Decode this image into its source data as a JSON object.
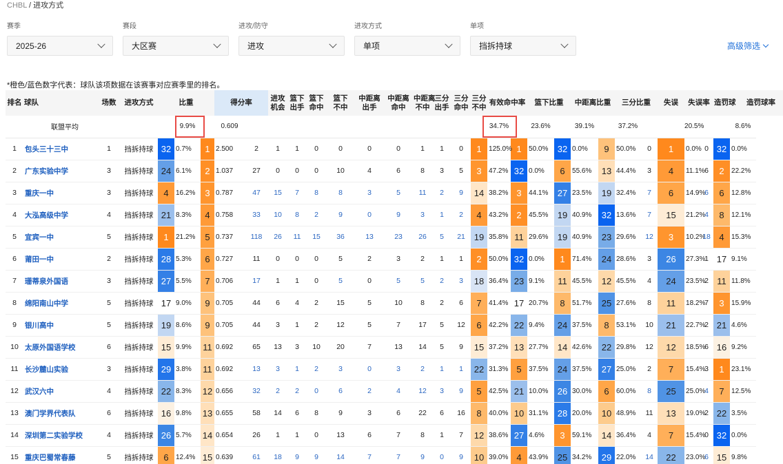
{
  "breadcrumb": {
    "root": "CHBL",
    "sep": " / ",
    "current": "进攻方式"
  },
  "filters": [
    {
      "label": "赛季",
      "value": "2025-26"
    },
    {
      "label": "赛段",
      "value": "大区赛"
    },
    {
      "label": "进攻/防守",
      "value": "进攻"
    },
    {
      "label": "进攻方式",
      "value": "单项"
    },
    {
      "label": "单项",
      "value": "挡拆持球"
    }
  ],
  "advanced_filter": "高级筛选",
  "note": "*橙色/蓝色数字代表：球队该项数据在该赛事对应赛季里的排名。",
  "columns": [
    "排名",
    "球队",
    "场数",
    "进攻方式",
    "比重",
    "得分率",
    "进攻\n机会",
    "篮下\n出手",
    "篮下\n命中",
    "篮下\n不中",
    "中距离\n出手",
    "中距离\n命中",
    "中距离\n不中",
    "三分\n出手",
    "三分\n命中",
    "三分\n不中",
    "有效命中率",
    "篮下比重",
    "中距离比重",
    "三分比重",
    "失误",
    "失误率",
    "造罚球",
    "造罚球率"
  ],
  "average_row": {
    "label": "联盟平均",
    "share": "9.9%",
    "ppp": "0.609",
    "efg": "34.7%",
    "rim_share": "23.6%",
    "mid_share": "39.1%",
    "three_share": "37.2%",
    "tov_rate": "20.5%",
    "ft_rate": "8.6%"
  },
  "rows": [
    {
      "rank": "1",
      "team": "包头三十三中",
      "games": "1",
      "type": "挡拆持球",
      "share_rk": "32",
      "share": "0.7%",
      "ppp_rk": "1",
      "ppp": "2.500",
      "poss": "2",
      "rim_fga": "1",
      "rim_fgm": "1",
      "rim_miss": "0",
      "mid_fga": "0",
      "mid_fgm": "0",
      "mid_miss": "0",
      "three_fga": "1",
      "three_fgm": "1",
      "three_miss": "0",
      "efg_rk": "1",
      "efg": "125.0%",
      "rim_rk": "1",
      "rim_share": "50.0%",
      "mid_rk": "32",
      "mid_share": "0.0%",
      "three_rk": "9",
      "three_share": "50.0%",
      "tov": "0",
      "tovr_rk": "1",
      "tov_rate": "0.0%",
      "fta": "0",
      "ftr_rk": "32",
      "ft_rate": "0.0%"
    },
    {
      "rank": "2",
      "team": "广东实验中学",
      "games": "3",
      "type": "挡拆持球",
      "share_rk": "24",
      "share": "6.1%",
      "ppp_rk": "2",
      "ppp": "1.037",
      "poss": "27",
      "rim_fga": "0",
      "rim_fgm": "0",
      "rim_miss": "0",
      "mid_fga": "10",
      "mid_fgm": "4",
      "mid_miss": "6",
      "three_fga": "8",
      "three_fgm": "3",
      "three_miss": "5",
      "efg_rk": "3",
      "efg": "47.2%",
      "rim_rk": "32",
      "rim_share": "0.0%",
      "mid_rk": "6",
      "mid_share": "55.6%",
      "three_rk": "13",
      "three_share": "44.4%",
      "tov": "3",
      "tovr_rk": "4",
      "tov_rate": "11.1%",
      "fta": "6",
      "ftr_rk": "2",
      "ft_rate": "22.2%"
    },
    {
      "rank": "3",
      "team": "重庆一中",
      "games": "3",
      "type": "挡拆持球",
      "share_rk": "4",
      "share": "16.2%",
      "ppp_rk": "3",
      "ppp": "0.787",
      "poss": "47",
      "rim_fga": "15",
      "rim_fgm": "7",
      "rim_miss": "8",
      "mid_fga": "8",
      "mid_fgm": "3",
      "mid_miss": "5",
      "three_fga": "11",
      "three_fgm": "2",
      "three_miss": "9",
      "efg_rk": "14",
      "efg": "38.2%",
      "rim_rk": "3",
      "rim_share": "44.1%",
      "mid_rk": "27",
      "mid_share": "23.5%",
      "three_rk": "19",
      "three_share": "32.4%",
      "tov": "7",
      "tovr_rk": "6",
      "tov_rate": "14.9%",
      "fta": "6",
      "ftr_rk": "6",
      "ft_rate": "12.8%"
    },
    {
      "rank": "4",
      "team": "大泓高级中学",
      "games": "4",
      "type": "挡拆持球",
      "share_rk": "21",
      "share": "8.3%",
      "ppp_rk": "4",
      "ppp": "0.758",
      "poss": "33",
      "rim_fga": "10",
      "rim_fgm": "8",
      "rim_miss": "2",
      "mid_fga": "9",
      "mid_fgm": "0",
      "mid_miss": "9",
      "three_fga": "3",
      "three_fgm": "1",
      "three_miss": "2",
      "efg_rk": "4",
      "efg": "43.2%",
      "rim_rk": "2",
      "rim_share": "45.5%",
      "mid_rk": "19",
      "mid_share": "40.9%",
      "three_rk": "32",
      "three_share": "13.6%",
      "tov": "7",
      "tovr_rk": "15",
      "tov_rate": "21.2%",
      "fta": "4",
      "ftr_rk": "8",
      "ft_rate": "12.1%"
    },
    {
      "rank": "5",
      "team": "宜宾一中",
      "games": "5",
      "type": "挡拆持球",
      "share_rk": "1",
      "share": "21.2%",
      "ppp_rk": "5",
      "ppp": "0.737",
      "poss": "118",
      "rim_fga": "26",
      "rim_fgm": "11",
      "rim_miss": "15",
      "mid_fga": "36",
      "mid_fgm": "13",
      "mid_miss": "23",
      "three_fga": "26",
      "three_fgm": "5",
      "three_miss": "21",
      "efg_rk": "19",
      "efg": "35.8%",
      "rim_rk": "11",
      "rim_share": "29.6%",
      "mid_rk": "19",
      "mid_share": "40.9%",
      "three_rk": "23",
      "three_share": "29.6%",
      "tov": "12",
      "tovr_rk": "3",
      "tov_rate": "10.2%",
      "fta": "18",
      "ftr_rk": "4",
      "ft_rate": "15.3%"
    },
    {
      "rank": "6",
      "team": "莆田一中",
      "games": "2",
      "type": "挡拆持球",
      "share_rk": "28",
      "share": "5.3%",
      "ppp_rk": "6",
      "ppp": "0.727",
      "poss": "11",
      "rim_fga": "0",
      "rim_fgm": "0",
      "rim_miss": "0",
      "mid_fga": "5",
      "mid_fgm": "2",
      "mid_miss": "3",
      "three_fga": "2",
      "three_fgm": "1",
      "three_miss": "1",
      "efg_rk": "2",
      "efg": "50.0%",
      "rim_rk": "32",
      "rim_share": "0.0%",
      "mid_rk": "1",
      "mid_share": "71.4%",
      "three_rk": "24",
      "three_share": "28.6%",
      "tov": "3",
      "tovr_rk": "26",
      "tov_rate": "27.3%",
      "fta": "1",
      "ftr_rk": "17",
      "ft_rate": "9.1%"
    },
    {
      "rank": "7",
      "team": "珊蒂泉外国语",
      "games": "3",
      "type": "挡拆持球",
      "share_rk": "27",
      "share": "5.5%",
      "ppp_rk": "7",
      "ppp": "0.706",
      "poss": "17",
      "rim_fga": "1",
      "rim_fgm": "1",
      "rim_miss": "0",
      "mid_fga": "5",
      "mid_fgm": "0",
      "mid_miss": "5",
      "three_fga": "5",
      "three_fgm": "2",
      "three_miss": "3",
      "efg_rk": "18",
      "efg": "36.4%",
      "rim_rk": "23",
      "rim_share": "9.1%",
      "mid_rk": "11",
      "mid_share": "45.5%",
      "three_rk": "12",
      "three_share": "45.5%",
      "tov": "4",
      "tovr_rk": "24",
      "tov_rate": "23.5%",
      "fta": "2",
      "ftr_rk": "11",
      "ft_rate": "11.8%"
    },
    {
      "rank": "8",
      "team": "绵阳南山中学",
      "games": "5",
      "type": "挡拆持球",
      "share_rk": "17",
      "share": "9.0%",
      "ppp_rk": "9",
      "ppp": "0.705",
      "poss": "44",
      "rim_fga": "6",
      "rim_fgm": "4",
      "rim_miss": "2",
      "mid_fga": "15",
      "mid_fgm": "5",
      "mid_miss": "10",
      "three_fga": "8",
      "three_fgm": "2",
      "three_miss": "6",
      "efg_rk": "7",
      "efg": "41.4%",
      "rim_rk": "17",
      "rim_share": "20.7%",
      "mid_rk": "8",
      "mid_share": "51.7%",
      "three_rk": "25",
      "three_share": "27.6%",
      "tov": "8",
      "tovr_rk": "11",
      "tov_rate": "18.2%",
      "fta": "7",
      "ftr_rk": "3",
      "ft_rate": "15.9%"
    },
    {
      "rank": "9",
      "team": "银川高中",
      "games": "5",
      "type": "挡拆持球",
      "share_rk": "19",
      "share": "8.6%",
      "ppp_rk": "9",
      "ppp": "0.705",
      "poss": "44",
      "rim_fga": "3",
      "rim_fgm": "1",
      "rim_miss": "2",
      "mid_fga": "12",
      "mid_fgm": "5",
      "mid_miss": "7",
      "three_fga": "17",
      "three_fgm": "5",
      "three_miss": "12",
      "efg_rk": "6",
      "efg": "42.2%",
      "rim_rk": "22",
      "rim_share": "9.4%",
      "mid_rk": "24",
      "mid_share": "37.5%",
      "three_rk": "8",
      "three_share": "53.1%",
      "tov": "10",
      "tovr_rk": "21",
      "tov_rate": "22.7%",
      "fta": "2",
      "ftr_rk": "21",
      "ft_rate": "4.6%"
    },
    {
      "rank": "10",
      "team": "太原外国语学校",
      "games": "6",
      "type": "挡拆持球",
      "share_rk": "15",
      "share": "9.9%",
      "ppp_rk": "11",
      "ppp": "0.692",
      "poss": "65",
      "rim_fga": "13",
      "rim_fgm": "3",
      "rim_miss": "10",
      "mid_fga": "20",
      "mid_fgm": "7",
      "mid_miss": "13",
      "three_fga": "14",
      "three_fgm": "5",
      "three_miss": "9",
      "efg_rk": "15",
      "efg": "37.2%",
      "rim_rk": "13",
      "rim_share": "27.7%",
      "mid_rk": "14",
      "mid_share": "42.6%",
      "three_rk": "22",
      "three_share": "29.8%",
      "tov": "12",
      "tovr_rk": "12",
      "tov_rate": "18.5%",
      "fta": "6",
      "ftr_rk": "16",
      "ft_rate": "9.2%"
    },
    {
      "rank": "11",
      "team": "长沙麓山实验",
      "games": "3",
      "type": "挡拆持球",
      "share_rk": "29",
      "share": "3.8%",
      "ppp_rk": "11",
      "ppp": "0.692",
      "poss": "13",
      "rim_fga": "3",
      "rim_fgm": "1",
      "rim_miss": "2",
      "mid_fga": "3",
      "mid_fgm": "0",
      "mid_miss": "3",
      "three_fga": "2",
      "three_fgm": "1",
      "three_miss": "1",
      "efg_rk": "22",
      "efg": "31.3%",
      "rim_rk": "5",
      "rim_share": "37.5%",
      "mid_rk": "24",
      "mid_share": "37.5%",
      "three_rk": "27",
      "three_share": "25.0%",
      "tov": "2",
      "tovr_rk": "7",
      "tov_rate": "15.4%",
      "fta": "3",
      "ftr_rk": "1",
      "ft_rate": "23.1%"
    },
    {
      "rank": "12",
      "team": "武汉六中",
      "games": "4",
      "type": "挡拆持球",
      "share_rk": "22",
      "share": "8.3%",
      "ppp_rk": "12",
      "ppp": "0.656",
      "poss": "32",
      "rim_fga": "2",
      "rim_fgm": "2",
      "rim_miss": "0",
      "mid_fga": "6",
      "mid_fgm": "2",
      "mid_miss": "4",
      "three_fga": "12",
      "three_fgm": "3",
      "three_miss": "9",
      "efg_rk": "5",
      "efg": "42.5%",
      "rim_rk": "21",
      "rim_share": "10.0%",
      "mid_rk": "26",
      "mid_share": "30.0%",
      "three_rk": "6",
      "three_share": "60.0%",
      "tov": "8",
      "tovr_rk": "25",
      "tov_rate": "25.0%",
      "fta": "4",
      "ftr_rk": "7",
      "ft_rate": "12.5%"
    },
    {
      "rank": "13",
      "team": "澳门学界代表队",
      "games": "6",
      "type": "挡拆持球",
      "share_rk": "16",
      "share": "9.8%",
      "ppp_rk": "13",
      "ppp": "0.655",
      "poss": "58",
      "rim_fga": "14",
      "rim_fgm": "6",
      "rim_miss": "8",
      "mid_fga": "9",
      "mid_fgm": "3",
      "mid_miss": "6",
      "three_fga": "22",
      "three_fgm": "6",
      "three_miss": "16",
      "efg_rk": "8",
      "efg": "40.0%",
      "rim_rk": "10",
      "rim_share": "31.1%",
      "mid_rk": "28",
      "mid_share": "20.0%",
      "three_rk": "10",
      "three_share": "48.9%",
      "tov": "11",
      "tovr_rk": "13",
      "tov_rate": "19.0%",
      "fta": "2",
      "ftr_rk": "22",
      "ft_rate": "3.5%"
    },
    {
      "rank": "14",
      "team": "深圳第二实验学校",
      "games": "4",
      "type": "挡拆持球",
      "share_rk": "26",
      "share": "5.7%",
      "ppp_rk": "14",
      "ppp": "0.654",
      "poss": "26",
      "rim_fga": "1",
      "rim_fgm": "1",
      "rim_miss": "0",
      "mid_fga": "13",
      "mid_fgm": "6",
      "mid_miss": "7",
      "three_fga": "8",
      "three_fgm": "1",
      "three_miss": "7",
      "efg_rk": "12",
      "efg": "38.6%",
      "rim_rk": "27",
      "rim_share": "4.6%",
      "mid_rk": "3",
      "mid_share": "59.1%",
      "three_rk": "14",
      "three_share": "36.4%",
      "tov": "4",
      "tovr_rk": "7",
      "tov_rate": "15.4%",
      "fta": "0",
      "ftr_rk": "32",
      "ft_rate": "0.0%"
    },
    {
      "rank": "15",
      "team": "重庆巴蜀常春藤",
      "games": "5",
      "type": "挡拆持球",
      "share_rk": "6",
      "share": "12.4%",
      "ppp_rk": "15",
      "ppp": "0.639",
      "poss": "61",
      "rim_fga": "18",
      "rim_fgm": "9",
      "rim_miss": "9",
      "mid_fga": "14",
      "mid_fgm": "7",
      "mid_miss": "7",
      "three_fga": "9",
      "three_fgm": "0",
      "three_miss": "9",
      "efg_rk": "10",
      "efg": "39.0%",
      "rim_rk": "4",
      "rim_share": "43.9%",
      "mid_rk": "25",
      "mid_share": "34.2%",
      "three_rk": "29",
      "three_share": "22.0%",
      "tov": "14",
      "tovr_rk": "22",
      "tov_rate": "23.0%",
      "fta": "6",
      "ftr_rk": "15",
      "ft_rate": "9.8%"
    }
  ]
}
